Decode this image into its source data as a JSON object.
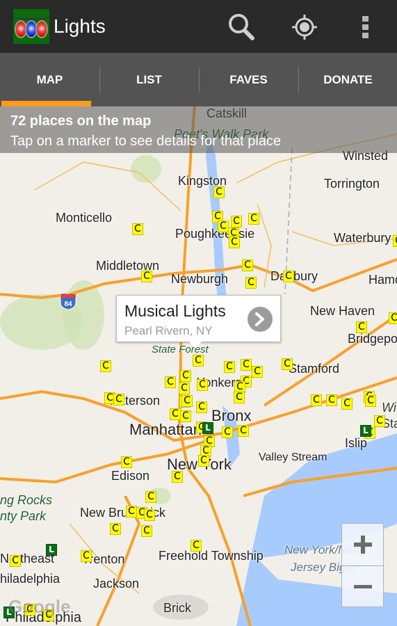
{
  "action_bar": {
    "app_title": "Lights",
    "icons": [
      "app-icon-lights",
      "search-icon",
      "my-location-icon",
      "overflow-menu-icon"
    ]
  },
  "tabs": [
    {
      "label": "MAP",
      "selected": true
    },
    {
      "label": "LIST",
      "selected": false
    },
    {
      "label": "FAVES",
      "selected": false
    },
    {
      "label": "DONATE",
      "selected": false
    }
  ],
  "colors": {
    "action_bar_bg": "#2a2a2a",
    "tab_bar_bg": "#535353",
    "tab_indicator": "#ff9c1f",
    "marker_c": "#ffff00",
    "marker_l": "#0a6e18",
    "water": "#a8cbfd",
    "highway": "#f7a02c"
  },
  "map_info": {
    "count_text": "72 places on the map",
    "hint_text": "Tap on a marker to see details for that place"
  },
  "info_window": {
    "title": "Musical Lights",
    "subtitle": "Pearl Rivern, NY"
  },
  "map_labels": {
    "catskill": "Catskill",
    "poets_walk": "Poet's Walk Park",
    "winsted": "Winsted",
    "kingston": "Kingston",
    "torrington": "Torrington",
    "monticello": "Monticello",
    "poughkeepsie": "Poughkeepsie",
    "waterbury": "Waterbury",
    "middletown": "Middletown",
    "newburgh": "Newburgh",
    "danbury": "Danbury",
    "hamden": "Hamden",
    "new_haven": "New Haven",
    "bridgeport": "Bridgeport",
    "state_forest": "State Forest",
    "stamford": "Stamford",
    "yonkers": "Yonkers",
    "paterson": "Paterson",
    "bronx": "Bronx",
    "manhattan": "Manhattan",
    "islip": "Islip",
    "new_york": "New York",
    "valley_stream": "Valley Stream",
    "edison": "Edison",
    "rocks_park_1": "ng Rocks",
    "rocks_park_2": "nty Park",
    "new_brunswick": "New Brunswick",
    "northeast": "Northeast",
    "trenton": "Trenton",
    "freehold": "Freehold Township",
    "ny_bight_1": "New York/New",
    "ny_bight_2": "Jersey Bight",
    "philadelphia_1": "hiladelphia",
    "jackson": "Jackson",
    "brick": "Brick",
    "philadelphia_2": "Philadelphia",
    "wi": "Wi",
    "sta": "Sta",
    "interstate": "84"
  },
  "markers": [
    {
      "type": "C",
      "label": "C"
    },
    {
      "type": "C",
      "label": "C"
    },
    {
      "type": "C",
      "label": "C"
    },
    {
      "type": "L",
      "label": "L"
    }
  ],
  "zoom_controls": {
    "zoom_in": "+",
    "zoom_out": "−"
  },
  "attribution": "Google"
}
